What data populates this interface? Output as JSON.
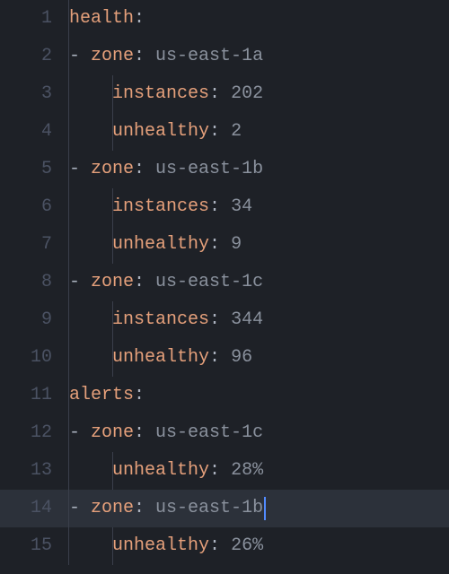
{
  "raw_yaml": "health:\n  - zone: us-east-1a\n    instances: 202\n    unhealthy: 2\n  - zone: us-east-1b\n    instances: 34\n    unhealthy: 9\n  - zone: us-east-1c\n    instances: 344\n    unhealthy: 96\nalerts:\n  - zone: us-east-1c\n    unhealthy: 28%\n  - zone: us-east-1b\n    unhealthy: 26%",
  "parsed": {
    "health": [
      {
        "zone": "us-east-1a",
        "instances": 202,
        "unhealthy": 2
      },
      {
        "zone": "us-east-1b",
        "instances": 34,
        "unhealthy": 9
      },
      {
        "zone": "us-east-1c",
        "instances": 344,
        "unhealthy": 96
      }
    ],
    "alerts": [
      {
        "zone": "us-east-1c",
        "unhealthy": "28%"
      },
      {
        "zone": "us-east-1b",
        "unhealthy": "26%"
      }
    ]
  },
  "editor_state": {
    "cursor_line": 14,
    "line_count": 15
  },
  "lines": [
    {
      "n": "1",
      "indent": 0,
      "guides": [],
      "dash": false,
      "key": "health",
      "sep": ":",
      "val": ""
    },
    {
      "n": "2",
      "indent": 1,
      "guides": [],
      "dash": true,
      "key": "zone",
      "sep": ": ",
      "val": "us-east-1a"
    },
    {
      "n": "3",
      "indent": 2,
      "guides": [
        2
      ],
      "dash": false,
      "key": "instances",
      "sep": ": ",
      "val": "202"
    },
    {
      "n": "4",
      "indent": 2,
      "guides": [
        2
      ],
      "dash": false,
      "key": "unhealthy",
      "sep": ": ",
      "val": "2"
    },
    {
      "n": "5",
      "indent": 1,
      "guides": [],
      "dash": true,
      "key": "zone",
      "sep": ": ",
      "val": "us-east-1b"
    },
    {
      "n": "6",
      "indent": 2,
      "guides": [
        2
      ],
      "dash": false,
      "key": "instances",
      "sep": ": ",
      "val": "34"
    },
    {
      "n": "7",
      "indent": 2,
      "guides": [
        2
      ],
      "dash": false,
      "key": "unhealthy",
      "sep": ": ",
      "val": "9"
    },
    {
      "n": "8",
      "indent": 1,
      "guides": [],
      "dash": true,
      "key": "zone",
      "sep": ": ",
      "val": "us-east-1c"
    },
    {
      "n": "9",
      "indent": 2,
      "guides": [
        2
      ],
      "dash": false,
      "key": "instances",
      "sep": ": ",
      "val": "344"
    },
    {
      "n": "10",
      "indent": 2,
      "guides": [
        2
      ],
      "dash": false,
      "key": "unhealthy",
      "sep": ": ",
      "val": "96"
    },
    {
      "n": "11",
      "indent": 0,
      "guides": [],
      "dash": false,
      "key": "alerts",
      "sep": ":",
      "val": ""
    },
    {
      "n": "12",
      "indent": 1,
      "guides": [],
      "dash": true,
      "key": "zone",
      "sep": ": ",
      "val": "us-east-1c"
    },
    {
      "n": "13",
      "indent": 2,
      "guides": [
        2
      ],
      "dash": false,
      "key": "unhealthy",
      "sep": ": ",
      "val": "28%"
    },
    {
      "n": "14",
      "indent": 1,
      "guides": [],
      "dash": true,
      "key": "zone",
      "sep": ": ",
      "val": "us-east-1b",
      "cursor": true,
      "hl": true
    },
    {
      "n": "15",
      "indent": 2,
      "guides": [
        2
      ],
      "dash": false,
      "key": "unhealthy",
      "sep": ": ",
      "val": "26%"
    }
  ]
}
